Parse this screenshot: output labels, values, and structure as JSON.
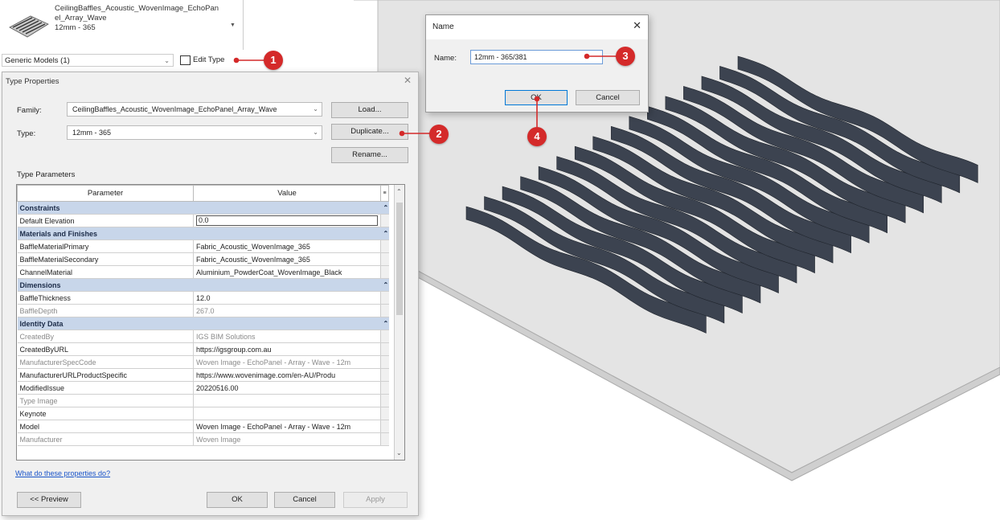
{
  "family_selector": {
    "name": "CeilingBaffles_Acoustic_WovenImage_EchoPanel_Array_Wave",
    "type": "12mm - 365",
    "category_filter": "Generic Models (1)",
    "edit_type_label": "Edit Type"
  },
  "type_properties": {
    "title": "Type Properties",
    "family_label": "Family:",
    "family_value": "CeilingBaffles_Acoustic_WovenImage_EchoPanel_Array_Wave",
    "type_label": "Type:",
    "type_value": "12mm - 365",
    "load_button": "Load...",
    "duplicate_button": "Duplicate...",
    "rename_button": "Rename...",
    "section_label": "Type Parameters",
    "col_parameter": "Parameter",
    "col_value": "Value",
    "groups": {
      "constraints": "Constraints",
      "materials": "Materials and Finishes",
      "dimensions": "Dimensions",
      "identity": "Identity Data"
    },
    "rows": {
      "default_elevation": [
        "Default Elevation",
        "0.0"
      ],
      "baffle_material_primary": [
        "BaffleMaterialPrimary",
        "Fabric_Acoustic_WovenImage_365"
      ],
      "baffle_material_secondary": [
        "BaffleMaterialSecondary",
        "Fabric_Acoustic_WovenImage_365"
      ],
      "channel_material": [
        "ChannelMaterial",
        "Aluminium_PowderCoat_WovenImage_Black"
      ],
      "baffle_thickness": [
        "BaffleThickness",
        "12.0"
      ],
      "baffle_depth": [
        "BaffleDepth",
        "267.0"
      ],
      "created_by": [
        "CreatedBy",
        "IGS BIM Solutions"
      ],
      "created_by_url": [
        "CreatedByURL",
        "https://igsgroup.com.au"
      ],
      "manufacturer_spec_code": [
        "ManufacturerSpecCode",
        "Woven Image - EchoPanel - Array - Wave - 12m"
      ],
      "manufacturer_url_product_specific": [
        "ManufacturerURLProductSpecific",
        "https://www.wovenimage.com/en-AU/Produ"
      ],
      "modified_issue": [
        "ModifiedIssue",
        "20220516.00"
      ],
      "type_image": [
        "Type Image",
        ""
      ],
      "keynote": [
        "Keynote",
        ""
      ],
      "model": [
        "Model",
        "Woven Image - EchoPanel - Array - Wave - 12m"
      ],
      "manufacturer": [
        "Manufacturer",
        "Woven Image"
      ]
    },
    "help_link": "What do these properties do?",
    "preview_button": "<< Preview",
    "ok_button": "OK",
    "cancel_button": "Cancel",
    "apply_button": "Apply"
  },
  "name_dialog": {
    "title": "Name",
    "name_label": "Name:",
    "name_value": "12mm - 365/381",
    "ok_button": "OK",
    "cancel_button": "Cancel"
  },
  "callouts": [
    "1",
    "2",
    "3",
    "4"
  ],
  "colors": {
    "callout": "#d42a2a",
    "group_header": "#c8d6ea",
    "baffle": "#3c4350",
    "floor": "#e4e4e4"
  }
}
